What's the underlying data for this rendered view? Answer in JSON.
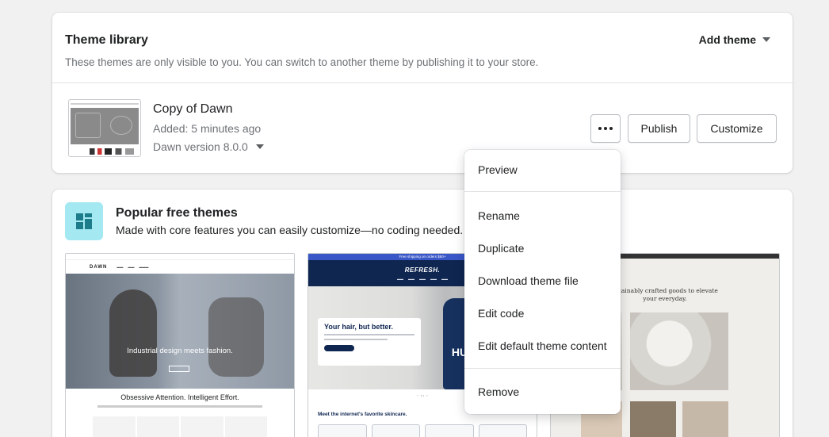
{
  "library": {
    "title": "Theme library",
    "subtitle": "These themes are only visible to you. You can switch to another theme by publishing it to your store.",
    "add_theme_label": "Add theme",
    "theme": {
      "name": "Copy of Dawn",
      "added": "Added: 5 minutes ago",
      "version": "Dawn version 8.0.0"
    },
    "publish_label": "Publish",
    "customize_label": "Customize"
  },
  "popular": {
    "title": "Popular free themes",
    "subtitle": "Made with core features you can easily customize—no coding needed.",
    "icon_color": "#a4e8f2",
    "previews": {
      "dawn": {
        "logo": "DAWN",
        "hero_text": "Industrial design meets fashion.",
        "tagline": "Obsessive Attention. Intelligent Effort."
      },
      "refresh": {
        "logo": "REFRESH.",
        "announcement": "Free shipping on orders $50+",
        "hero_title": "Your hair, but better.",
        "bottle_text": "HU",
        "products_heading": "Meet the internet's favorite skincare."
      },
      "craft": {
        "title_line1": "ustainably crafted goods to elevate",
        "title_line2": "your everyday."
      }
    }
  },
  "menu": {
    "items": [
      {
        "label": "Preview"
      },
      {
        "label": "Rename"
      },
      {
        "label": "Duplicate"
      },
      {
        "label": "Download theme file"
      },
      {
        "label": "Edit code"
      },
      {
        "label": "Edit default theme content"
      },
      {
        "label": "Remove"
      }
    ]
  },
  "colors": {
    "page_bg": "#f1f1f1",
    "refresh_navy": "#0f2651",
    "refresh_blue": "#3a57c8"
  }
}
